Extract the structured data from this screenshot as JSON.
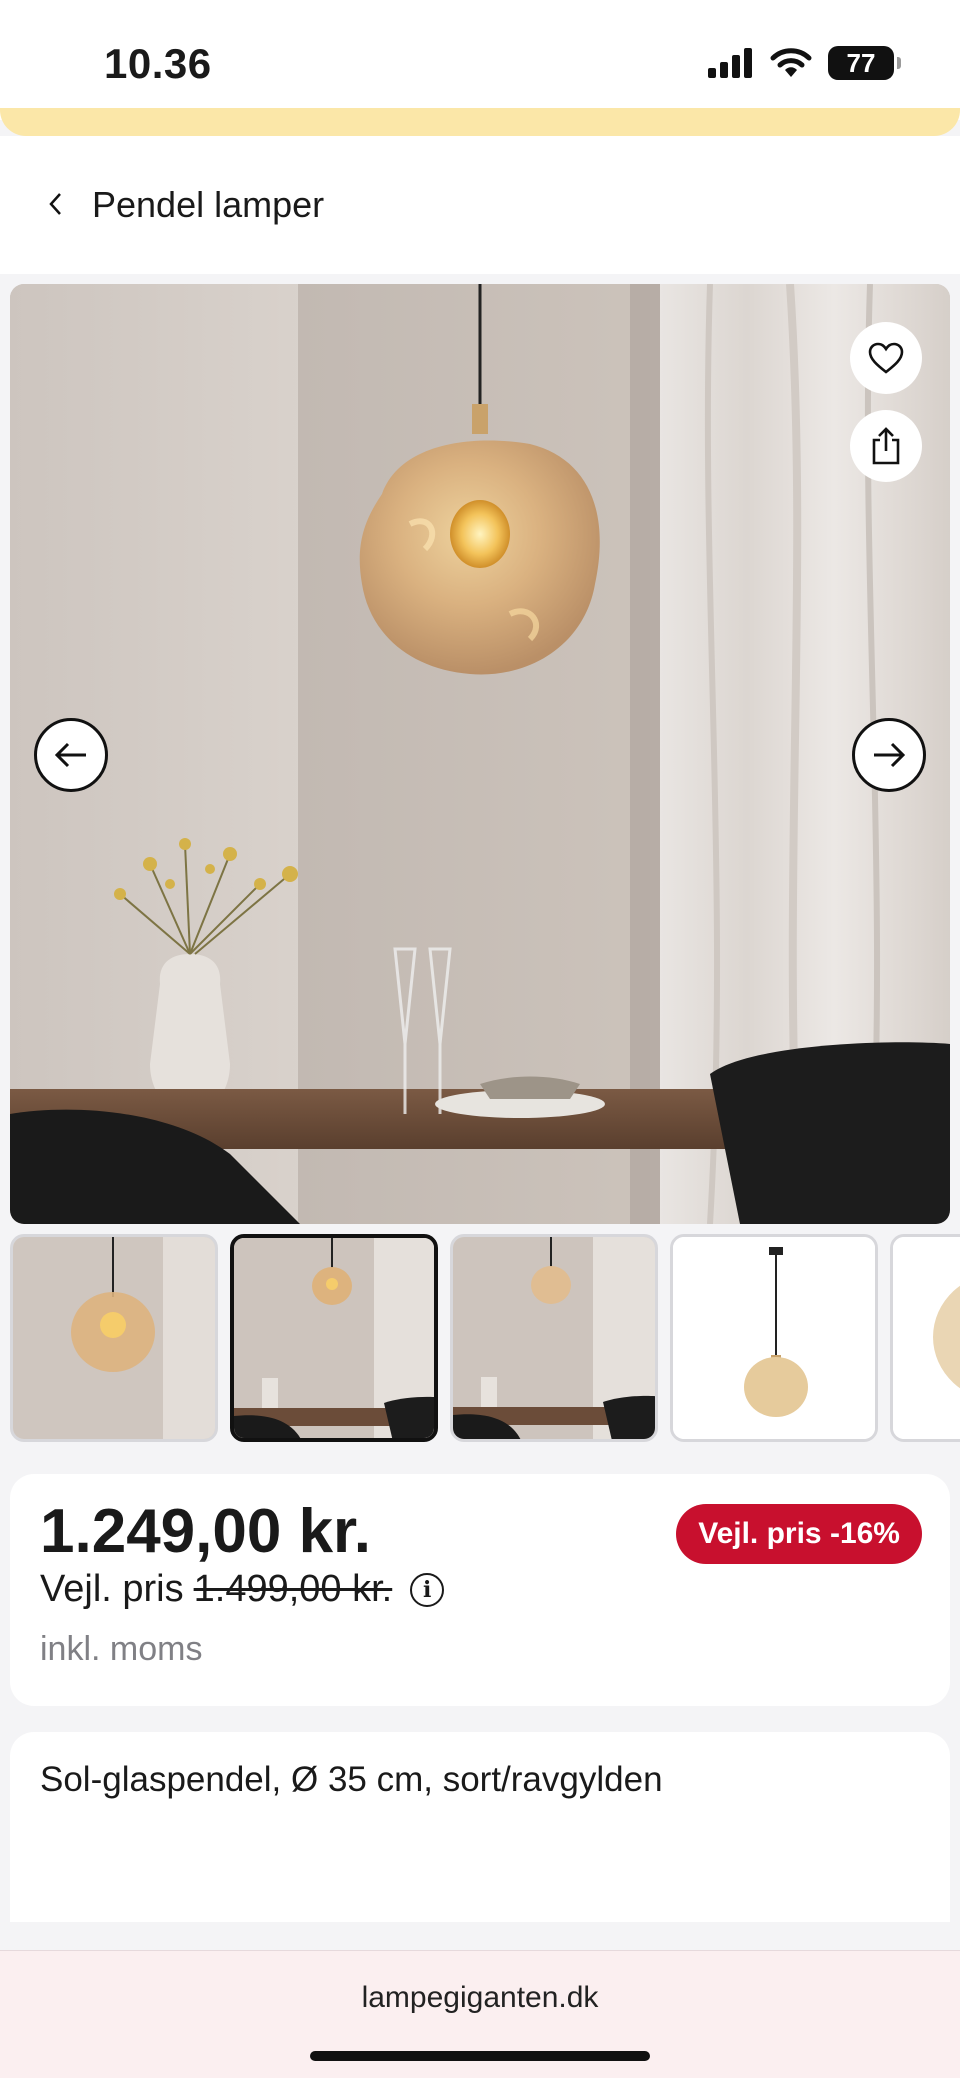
{
  "status_bar": {
    "time": "10.36",
    "battery": "77"
  },
  "nav": {
    "back_label": "Pendel lamper"
  },
  "gallery": {
    "actions": [
      "heart-icon",
      "share-icon"
    ],
    "prev": "arrow-left-icon",
    "next": "arrow-right-icon",
    "selected_thumbnail": 2,
    "thumbnail_count": 5
  },
  "price": {
    "current": "1.249,00 kr.",
    "compare_label": "Vejl. pris",
    "compare_value": "1.499,00 kr.",
    "tax_note": "inkl. moms",
    "discount_badge": "Vejl. pris -16%",
    "badge_color": "#c8102e"
  },
  "product": {
    "title": "Sol-glaspendel, Ø 35 cm, sort/ravgylden"
  },
  "browser": {
    "url": "lampegiganten.dk"
  }
}
